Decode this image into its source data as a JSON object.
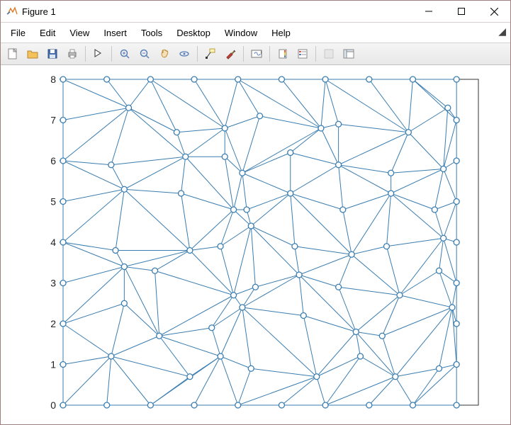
{
  "window": {
    "title": "Figure 1"
  },
  "menu": {
    "items": [
      "File",
      "Edit",
      "View",
      "Insert",
      "Tools",
      "Desktop",
      "Window",
      "Help"
    ]
  },
  "toolbar": {
    "buttons": [
      "new-figure",
      "open-file",
      "save-figure",
      "print-figure",
      "|",
      "edit-plot",
      "|",
      "zoom-in",
      "zoom-out",
      "pan",
      "rotate-3d",
      "|",
      "data-cursor",
      "brush",
      "|",
      "link-plot",
      "|",
      "insert-colorbar",
      "insert-legend",
      "|",
      "hide-plot-tools",
      "show-plot-tools"
    ]
  },
  "chart_data": {
    "type": "scatter",
    "title": "",
    "xlabel": "",
    "ylabel": "",
    "xlim": [
      0,
      9.5
    ],
    "ylim": [
      0,
      8
    ],
    "yticks": [
      0,
      1,
      2,
      3,
      4,
      5,
      6,
      7,
      8
    ],
    "series": [
      {
        "name": "nodes",
        "type": "scatter",
        "marker": "circle",
        "x": [
          0,
          1,
          2,
          3,
          4,
          5,
          6,
          7,
          8,
          9,
          0,
          1,
          2,
          3,
          4,
          5,
          6,
          7,
          8,
          9,
          0,
          1,
          2,
          3,
          4,
          5,
          6,
          7,
          8,
          9,
          0,
          1,
          2,
          3,
          4,
          5,
          6,
          7,
          8,
          9,
          0,
          1,
          2,
          3,
          4,
          5,
          6,
          7,
          8,
          9,
          0,
          1,
          2,
          3,
          4,
          5,
          6,
          7,
          8,
          9,
          0,
          1,
          2,
          3,
          4,
          5,
          6,
          7,
          8,
          9,
          0,
          1,
          2,
          3,
          4,
          5,
          6,
          7,
          8,
          9,
          0,
          1,
          2,
          3,
          4,
          5,
          6,
          7,
          8,
          9
        ],
        "y": [
          8,
          8,
          8,
          8,
          8,
          8,
          8,
          8,
          8,
          8,
          7,
          7,
          7,
          7,
          7,
          7,
          7,
          7,
          7,
          7,
          6,
          6,
          6,
          6,
          6,
          6,
          6,
          6,
          6,
          6,
          5,
          5,
          5,
          5,
          5,
          5,
          5,
          5,
          5,
          5,
          4,
          4,
          4,
          4,
          4,
          4,
          4,
          4,
          4,
          4,
          3,
          3,
          3,
          3,
          3,
          3,
          3,
          3,
          3,
          3,
          2,
          2,
          2,
          2,
          2,
          2,
          2,
          2,
          2,
          2,
          1,
          1,
          1,
          1,
          1,
          1,
          1,
          1,
          1,
          1,
          0,
          0,
          0,
          0,
          0,
          0,
          0,
          0,
          0,
          0
        ],
        "dx": [
          0,
          0,
          0,
          0,
          0,
          0,
          0,
          0,
          0,
          0,
          0,
          0.5,
          0.6,
          0.7,
          0.5,
          0.9,
          0.3,
          0.9,
          0.8,
          0,
          0,
          0.1,
          0.8,
          0.7,
          0.1,
          0.2,
          0.3,
          0.5,
          0.7,
          0,
          0,
          0.4,
          0.7,
          0.9,
          0.2,
          0.2,
          0.4,
          0.5,
          0.5,
          0,
          0,
          0.2,
          0.9,
          0.6,
          0.3,
          0.3,
          0.6,
          0.4,
          0.7,
          0,
          0,
          0.4,
          0.1,
          0.9,
          0.4,
          0.4,
          0.3,
          0.7,
          0.6,
          0,
          0,
          0.4,
          0.2,
          0.4,
          0.1,
          0.5,
          0.7,
          0.3,
          0.9,
          0,
          0,
          0.1,
          0.9,
          0.6,
          0.3,
          0.8,
          0.8,
          0.6,
          0.6,
          0,
          0,
          0,
          0,
          0,
          0,
          0,
          0,
          0,
          0,
          0
        ],
        "dy": [
          0,
          0,
          0,
          0,
          0,
          0,
          0,
          0,
          0,
          0,
          0,
          0.3,
          -0.3,
          -0.2,
          0.1,
          -0.2,
          -0.1,
          -0.3,
          0.3,
          0,
          0,
          -0.1,
          0.1,
          0.1,
          -0.3,
          0.2,
          -0.1,
          -0.3,
          -0.2,
          0,
          0,
          0.3,
          0.2,
          -0.2,
          -0.2,
          0.2,
          -0.2,
          0.2,
          -0.2,
          0,
          0,
          -0.2,
          -0.2,
          -0.1,
          0.4,
          -0.1,
          -0.3,
          -0.1,
          0.1,
          0,
          0,
          0.4,
          0.3,
          -0.3,
          -0.1,
          0.2,
          -0.1,
          -0.3,
          0.3,
          0,
          0,
          0.5,
          -0.3,
          -0.1,
          0.4,
          0.2,
          -0.2,
          -0.3,
          0.4,
          0,
          0,
          0.2,
          -0.3,
          0.2,
          -0.1,
          -0.3,
          0.2,
          -0.3,
          -0.1,
          0,
          0,
          0,
          0,
          0,
          0,
          0,
          0,
          0,
          0,
          0
        ]
      },
      {
        "name": "mesh-edges",
        "type": "line",
        "note": "triangulated mesh connectivity between neighboring perturbed grid nodes"
      }
    ],
    "color": "#3a7db0"
  }
}
